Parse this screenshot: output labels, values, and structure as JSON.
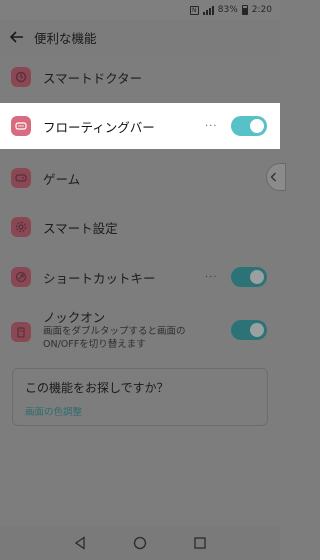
{
  "status_bar": {
    "nfc_label": "N",
    "battery": "83%",
    "time": "2:20",
    "icons": [
      "nfc-icon",
      "signal-icon",
      "battery-icon"
    ]
  },
  "app_bar": {
    "title": "便利な機能",
    "back_icon": "arrow-left-icon"
  },
  "items": [
    {
      "label": "スマートドクター",
      "icon": "doctor-icon"
    },
    {
      "label": "フローティングバー",
      "icon": "floating-bar-icon",
      "has_more": true,
      "more_label": "···",
      "toggle_on": true,
      "highlighted": true
    },
    {
      "label": "ゲーム",
      "icon": "game-icon"
    },
    {
      "label": "スマート設定",
      "icon": "settings-icon"
    },
    {
      "label": "ショートカットキー",
      "icon": "shortcut-icon",
      "has_more": true,
      "more_label": "···",
      "toggle_on": true
    },
    {
      "label": "ノックオン",
      "icon": "knock-on-icon",
      "subtitle": "画面をダブルタップすると画面のON/OFFを切り替えます",
      "toggle_on": true
    }
  ],
  "suggestion": {
    "title": "この機能をお探しですか？",
    "link": "画面の色調整"
  },
  "nav_bar": {
    "icons": [
      "back-icon",
      "home-icon",
      "recents-icon"
    ]
  },
  "colors": {
    "accent": "#56c1c7",
    "icon_pink": "#d86b7f",
    "overlay": "#7d7d7d"
  }
}
